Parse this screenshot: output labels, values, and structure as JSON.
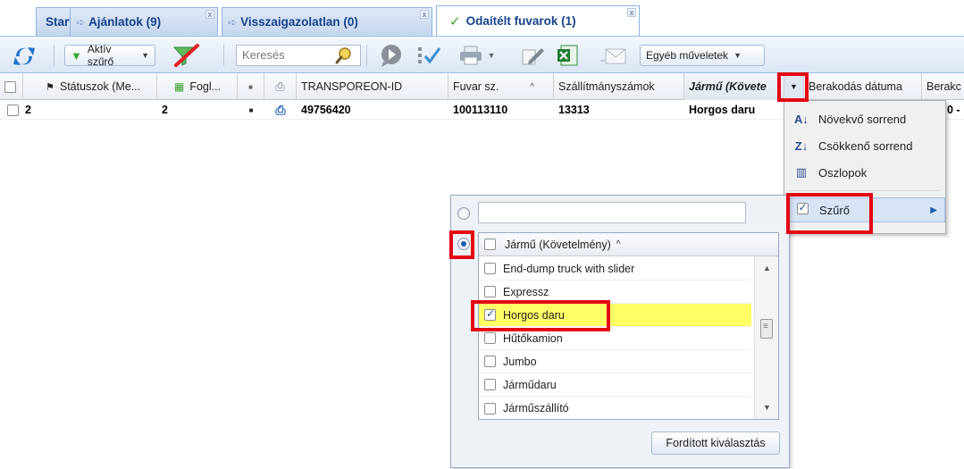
{
  "tabs": [
    {
      "label": "Start"
    },
    {
      "label": "Ajánlatok (9)"
    },
    {
      "label": "Visszaigazolatlan (0)"
    },
    {
      "label": "Odaítélt fuvarok (1)"
    }
  ],
  "toolbar": {
    "active_filter_label": "Aktív szűrő",
    "search_placeholder": "Keresés",
    "other_actions_label": "Egyéb műveletek"
  },
  "grid": {
    "columns": [
      "Státuszok (Me...",
      "Fogl...",
      "",
      "",
      "TRANSPOREON-ID",
      "Fuvar sz.",
      "Szállítmányszámok",
      "Jármű (Követe",
      "Berakodás dátuma",
      "Berakc"
    ],
    "row": {
      "status": "2",
      "fogl": "2",
      "transporeon_id": "49756420",
      "fuvar_sz": "100113110",
      "szallitmanyszamok": "13313",
      "jarmu": "Horgos daru",
      "berak_trunc": "0 -"
    }
  },
  "column_menu": {
    "items": [
      {
        "label": "Növekvő sorrend",
        "icon": "sort-ascending-icon"
      },
      {
        "label": "Csökkenő sorrend",
        "icon": "sort-descending-icon"
      },
      {
        "label": "Oszlopok",
        "icon": "columns-icon"
      },
      {
        "label": "Szűrő",
        "icon": "checkbox-icon"
      }
    ]
  },
  "filter_panel": {
    "list_header": "Jármű (Követelmény)",
    "options": [
      {
        "label": "End-dump truck with slider",
        "checked": false
      },
      {
        "label": "Expressz",
        "checked": false
      },
      {
        "label": "Horgos daru",
        "checked": true
      },
      {
        "label": "Hűtőkamion",
        "checked": false
      },
      {
        "label": "Jumbo",
        "checked": false
      },
      {
        "label": "Járműdaru",
        "checked": false
      },
      {
        "label": "Járműszállító",
        "checked": false
      }
    ],
    "invert_button": "Fordított kiválasztás"
  },
  "colors": {
    "tab_text": "#15428b",
    "highlight": "#e30613",
    "selected_row": "#ffff66"
  }
}
